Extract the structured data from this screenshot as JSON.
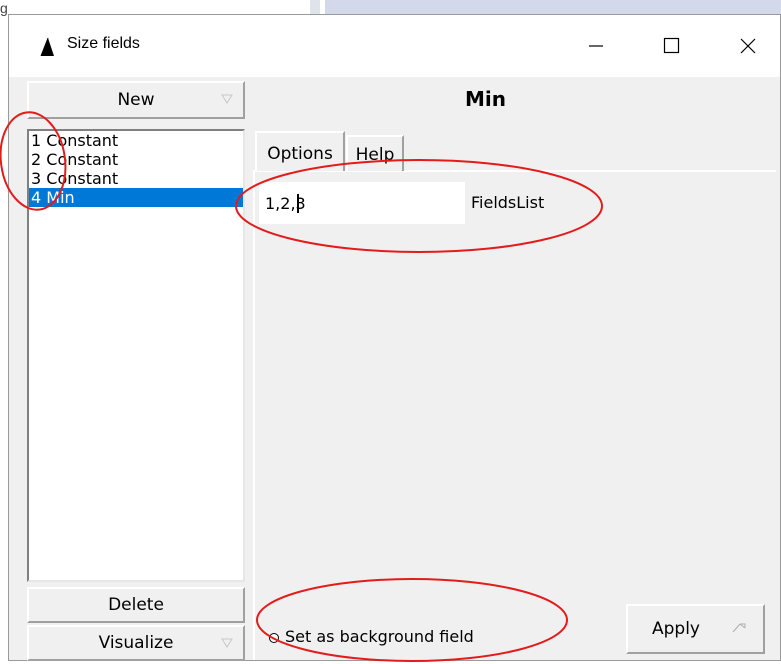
{
  "background": {
    "partial_text": "g"
  },
  "window": {
    "title": "Size fields"
  },
  "left_panel": {
    "new_label": "New",
    "items": [
      {
        "label": "1 Constant",
        "selected": false
      },
      {
        "label": "2 Constant",
        "selected": false
      },
      {
        "label": "3 Constant",
        "selected": false
      },
      {
        "label": "4 Min",
        "selected": true
      }
    ],
    "delete_label": "Delete",
    "visualize_label": "Visualize"
  },
  "right_panel": {
    "title": "Min",
    "tabs": [
      {
        "label": "Options",
        "active": true
      },
      {
        "label": "Help",
        "active": false
      }
    ],
    "fields_list": {
      "value": "1,2,3",
      "label": "FieldsList"
    },
    "background_field": {
      "label": "Set as background field",
      "checked": false
    },
    "apply_label": "Apply"
  },
  "colors": {
    "selection": "#0078d7",
    "annotation": "#e41b1b",
    "window_bg": "#f0f0f0"
  },
  "icons": {
    "app": "sail-icon",
    "minimize": "minimize-icon",
    "maximize": "maximize-icon",
    "close": "close-icon",
    "menu_arrow": "menu-arrow-icon"
  }
}
